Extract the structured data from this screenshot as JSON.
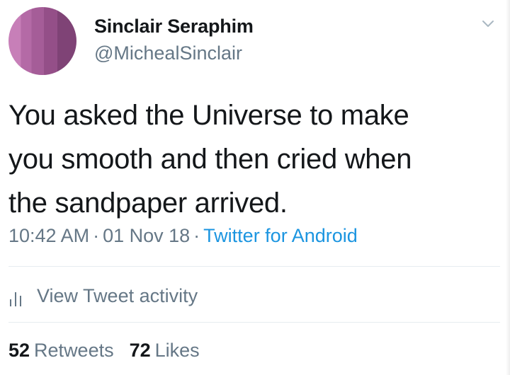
{
  "user": {
    "display_name": "Sinclair Seraphim",
    "handle": "@MichealSinclair",
    "avatar_icon": "avatar-image"
  },
  "tweet": {
    "text": "You asked the Universe to make\nyou smooth and then cried when\nthe sandpaper arrived."
  },
  "meta": {
    "time": "10:42 AM",
    "separator": "·",
    "date": "01 Nov 18",
    "source": "Twitter for Android"
  },
  "activity": {
    "icon": "bar-chart-icon",
    "label": "View Tweet activity"
  },
  "stats": {
    "retweets_count": "52",
    "retweets_label": "Retweets",
    "likes_count": "72",
    "likes_label": "Likes"
  },
  "menu": {
    "icon": "chevron-down-icon"
  },
  "colors": {
    "text_primary": "#14171a",
    "text_secondary": "#657786",
    "link": "#1b95e0",
    "divider": "#e6ecf0"
  }
}
